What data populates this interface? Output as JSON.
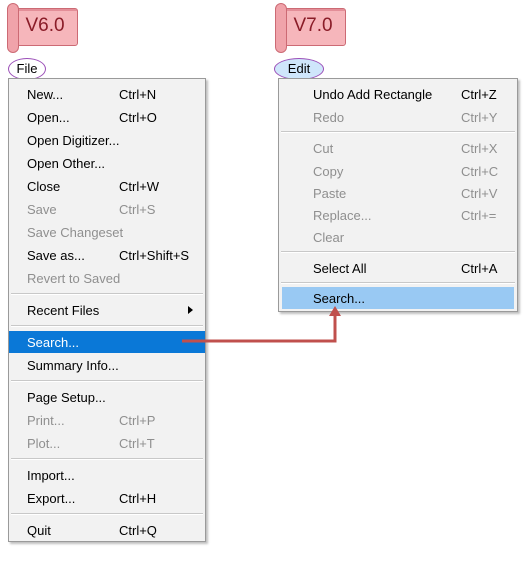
{
  "banners": {
    "left": "V6.0",
    "right": "V7.0"
  },
  "menubar": {
    "file": "File",
    "edit": "Edit"
  },
  "file_menu": {
    "items": [
      {
        "label": "New...",
        "shortcut": "Ctrl+N",
        "disabled": false
      },
      {
        "label": "Open...",
        "shortcut": "Ctrl+O",
        "disabled": false
      },
      {
        "label": "Open Digitizer...",
        "shortcut": "",
        "disabled": false
      },
      {
        "label": "Open Other...",
        "shortcut": "",
        "disabled": false
      },
      {
        "label": "Close",
        "shortcut": "Ctrl+W",
        "disabled": false
      },
      {
        "label": "Save",
        "shortcut": "Ctrl+S",
        "disabled": true
      },
      {
        "label": "Save Changeset",
        "shortcut": "",
        "disabled": true
      },
      {
        "label": "Save as...",
        "shortcut": "Ctrl+Shift+S",
        "disabled": false
      },
      {
        "label": "Revert to Saved",
        "shortcut": "",
        "disabled": true
      },
      {
        "label": "Recent Files",
        "shortcut": "",
        "disabled": false
      },
      {
        "label": "Search...",
        "shortcut": "",
        "disabled": false
      },
      {
        "label": "Summary Info...",
        "shortcut": "",
        "disabled": false
      },
      {
        "label": "Page Setup...",
        "shortcut": "",
        "disabled": false
      },
      {
        "label": "Print...",
        "shortcut": "Ctrl+P",
        "disabled": true
      },
      {
        "label": "Plot...",
        "shortcut": "Ctrl+T",
        "disabled": true
      },
      {
        "label": "Import...",
        "shortcut": "",
        "disabled": false
      },
      {
        "label": "Export...",
        "shortcut": "Ctrl+H",
        "disabled": false
      },
      {
        "label": "Quit",
        "shortcut": "Ctrl+Q",
        "disabled": false
      }
    ]
  },
  "edit_menu": {
    "items": [
      {
        "label": "Undo Add Rectangle",
        "shortcut": "Ctrl+Z",
        "disabled": false
      },
      {
        "label": "Redo",
        "shortcut": "Ctrl+Y",
        "disabled": true
      },
      {
        "label": "Cut",
        "shortcut": "Ctrl+X",
        "disabled": true
      },
      {
        "label": "Copy",
        "shortcut": "Ctrl+C",
        "disabled": true
      },
      {
        "label": "Paste",
        "shortcut": "Ctrl+V",
        "disabled": true
      },
      {
        "label": "Replace...",
        "shortcut": "Ctrl+=",
        "disabled": true
      },
      {
        "label": "Clear",
        "shortcut": "",
        "disabled": true
      },
      {
        "label": "Select All",
        "shortcut": "Ctrl+A",
        "disabled": false
      },
      {
        "label": "Search...",
        "shortcut": "",
        "disabled": false
      }
    ]
  },
  "colors": {
    "highlight": "#0a78d7",
    "hover": "#99c9f3",
    "arrow": "#c0504d",
    "banner": "#f6b6bb"
  }
}
